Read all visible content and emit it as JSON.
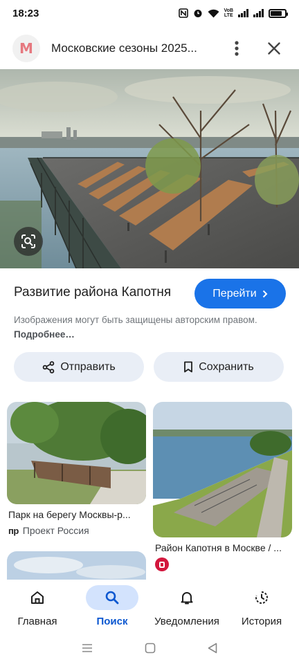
{
  "status": {
    "time": "18:23",
    "battery_pct": 80,
    "net_label_top": "VoB",
    "net_label_bottom": "LTE"
  },
  "header": {
    "logo_letter": "М",
    "title": "Московские сезоны 2025..."
  },
  "result": {
    "title": "Развитие района Капотня",
    "go_label": "Перейти",
    "copyright_text": "Изображения могут быть защищены авторским правом.",
    "more_label": "Подробнее…",
    "share_label": "Отправить",
    "save_label": "Сохранить"
  },
  "grid": [
    {
      "title": "Парк на берегу Москвы-р...",
      "source_badge": "пр",
      "source": "Проект Россия"
    },
    {
      "title": "Район Капотня в Москве / ...",
      "source_badge": "",
      "source": ""
    }
  ],
  "nav": [
    {
      "label": "Главная",
      "icon": "home-icon",
      "active": false
    },
    {
      "label": "Поиск",
      "icon": "search-icon",
      "active": true
    },
    {
      "label": "Уведомления",
      "icon": "bell-icon",
      "active": false
    },
    {
      "label": "История",
      "icon": "history-icon",
      "active": false
    }
  ],
  "colors": {
    "accent": "#1a73e8",
    "pill_bg": "#e9eef6",
    "nav_active_bg": "#d3e3fd",
    "nav_active_text": "#0b57d0"
  }
}
